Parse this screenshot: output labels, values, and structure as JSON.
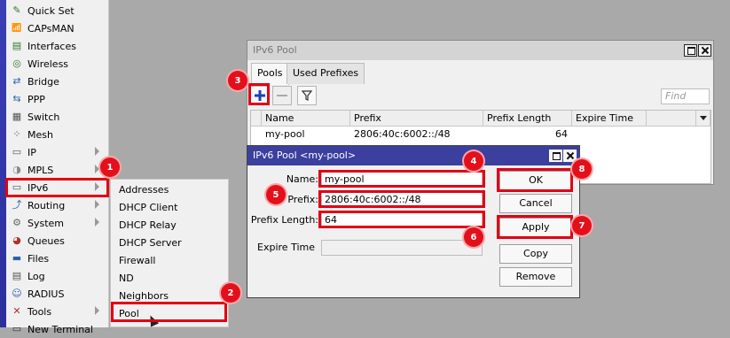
{
  "sidebar": {
    "items": [
      {
        "label": "Quick Set",
        "icon": "quick-set-icon",
        "glyph": "✎"
      },
      {
        "label": "CAPsMAN",
        "icon": "capsman-icon",
        "glyph": "📶"
      },
      {
        "label": "Interfaces",
        "icon": "interfaces-icon",
        "glyph": "▤"
      },
      {
        "label": "Wireless",
        "icon": "wireless-icon",
        "glyph": "◎"
      },
      {
        "label": "Bridge",
        "icon": "bridge-icon",
        "glyph": "⇄"
      },
      {
        "label": "PPP",
        "icon": "ppp-icon",
        "glyph": "⇆"
      },
      {
        "label": "Switch",
        "icon": "switch-icon",
        "glyph": "▦"
      },
      {
        "label": "Mesh",
        "icon": "mesh-icon",
        "glyph": "⁘"
      },
      {
        "label": "IP",
        "icon": "ip-icon",
        "glyph": "▭"
      },
      {
        "label": "MPLS",
        "icon": "mpls-icon",
        "glyph": "◑"
      },
      {
        "label": "IPv6",
        "icon": "ipv6-icon",
        "glyph": "▭"
      },
      {
        "label": "Routing",
        "icon": "routing-icon",
        "glyph": "⤴"
      },
      {
        "label": "System",
        "icon": "system-icon",
        "glyph": "⚙"
      },
      {
        "label": "Queues",
        "icon": "queues-icon",
        "glyph": "◕"
      },
      {
        "label": "Files",
        "icon": "files-icon",
        "glyph": "▬"
      },
      {
        "label": "Log",
        "icon": "log-icon",
        "glyph": "▤"
      },
      {
        "label": "RADIUS",
        "icon": "radius-icon",
        "glyph": "☺"
      },
      {
        "label": "Tools",
        "icon": "tools-icon",
        "glyph": "✕"
      },
      {
        "label": "New Terminal",
        "icon": "terminal-icon",
        "glyph": "▭"
      }
    ]
  },
  "submenu": {
    "items": [
      "Addresses",
      "DHCP Client",
      "DHCP Relay",
      "DHCP Server",
      "Firewall",
      "ND",
      "Neighbors",
      "Pool"
    ]
  },
  "window": {
    "title": "IPv6 Pool",
    "tabs": [
      "Pools",
      "Used Prefixes"
    ],
    "find_placeholder": "Find",
    "columns": [
      "Name",
      "Prefix",
      "Prefix Length",
      "Expire Time"
    ],
    "rows": [
      {
        "name": "my-pool",
        "prefix": "2806:40c:6002::/48",
        "prefix_length": "64",
        "expire_time": ""
      }
    ]
  },
  "dialog": {
    "title": "IPv6 Pool <my-pool>",
    "name_label": "Name:",
    "name_value": "my-pool",
    "prefix_label": "Prefix:",
    "prefix_value": "2806:40c:6002::/48",
    "prefix_length_label": "Prefix Length:",
    "prefix_length_value": "64",
    "expire_label": "Expire Time",
    "buttons": {
      "ok": "OK",
      "cancel": "Cancel",
      "apply": "Apply",
      "copy": "Copy",
      "remove": "Remove"
    }
  },
  "annotations": {
    "badges": [
      "1",
      "2",
      "3",
      "4",
      "5",
      "6",
      "7",
      "8"
    ],
    "highlight_color": "#e10014",
    "titlebar_color": "#3b3f9e"
  }
}
